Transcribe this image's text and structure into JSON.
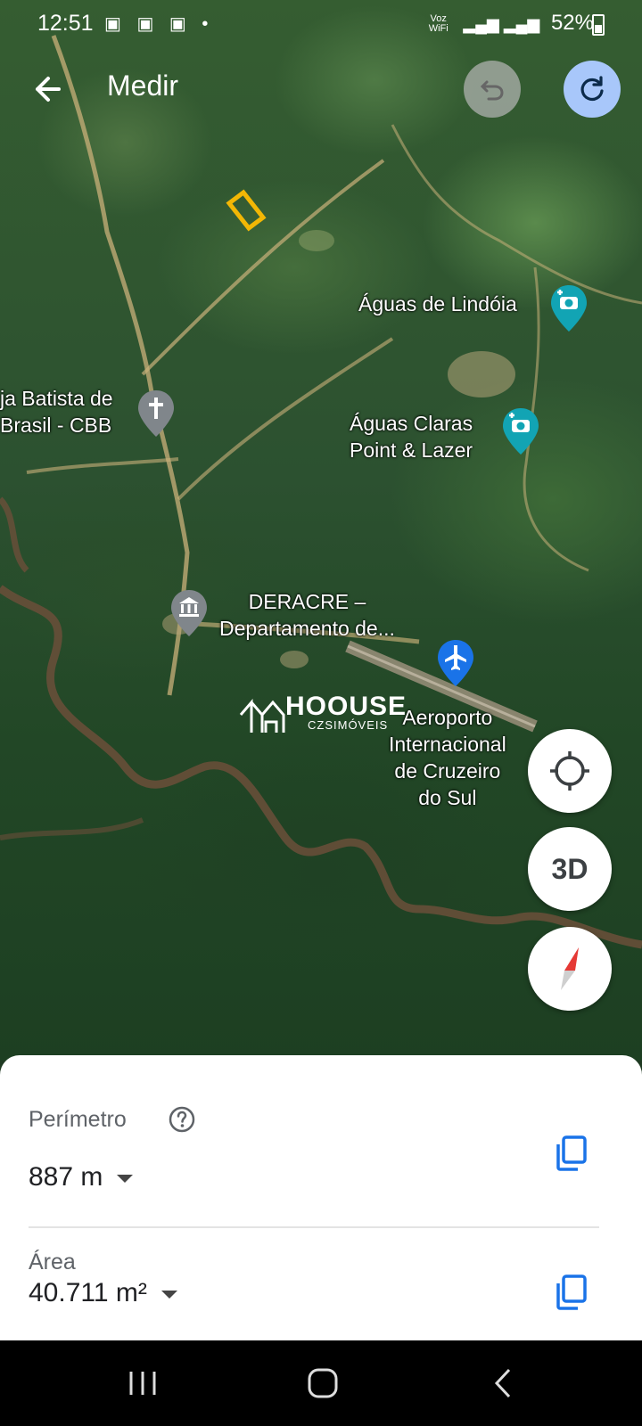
{
  "status_bar": {
    "time": "12:51",
    "network_label": "Voz WiFi",
    "battery": "52%"
  },
  "toolbar": {
    "title": "Medir",
    "back_icon": "arrow-back-icon",
    "undo_icon": "undo-icon",
    "redo_icon": "redo-icon"
  },
  "map": {
    "places": [
      {
        "name": "Águas de Lindóia",
        "icon": "camera-pin-icon"
      },
      {
        "name": "ja Batista de",
        "name2": "Brasil - CBB",
        "icon": "church-pin-icon"
      },
      {
        "name": "Águas Claras",
        "name2": "Point & Lazer",
        "icon": "camera-pin-icon"
      },
      {
        "name": "DERACRE –",
        "name2": "Departamento de...",
        "icon": "government-pin-icon"
      },
      {
        "name": "Aeroporto",
        "name2": "Internacional",
        "name3": "de Cruzeiro",
        "name4": "do Sul",
        "icon": "airport-pin-icon"
      }
    ],
    "watermark": {
      "brand": "HOOUSE",
      "sub": "CZSIMÓVEIS"
    },
    "buttons": {
      "location_icon": "my-location-icon",
      "view_3d": "3D",
      "compass_icon": "compass-icon"
    }
  },
  "measure": {
    "perimeter_label": "Perímetro",
    "perimeter_value": "887 m",
    "area_label": "Área",
    "area_value": "40.711 m²"
  },
  "colors": {
    "accent_blue": "#1a73e8",
    "redo_bg": "#a8c7fa",
    "marker_teal": "#12a4b4",
    "marker_gray": "#80868b",
    "measure_outline": "#f2b705"
  }
}
